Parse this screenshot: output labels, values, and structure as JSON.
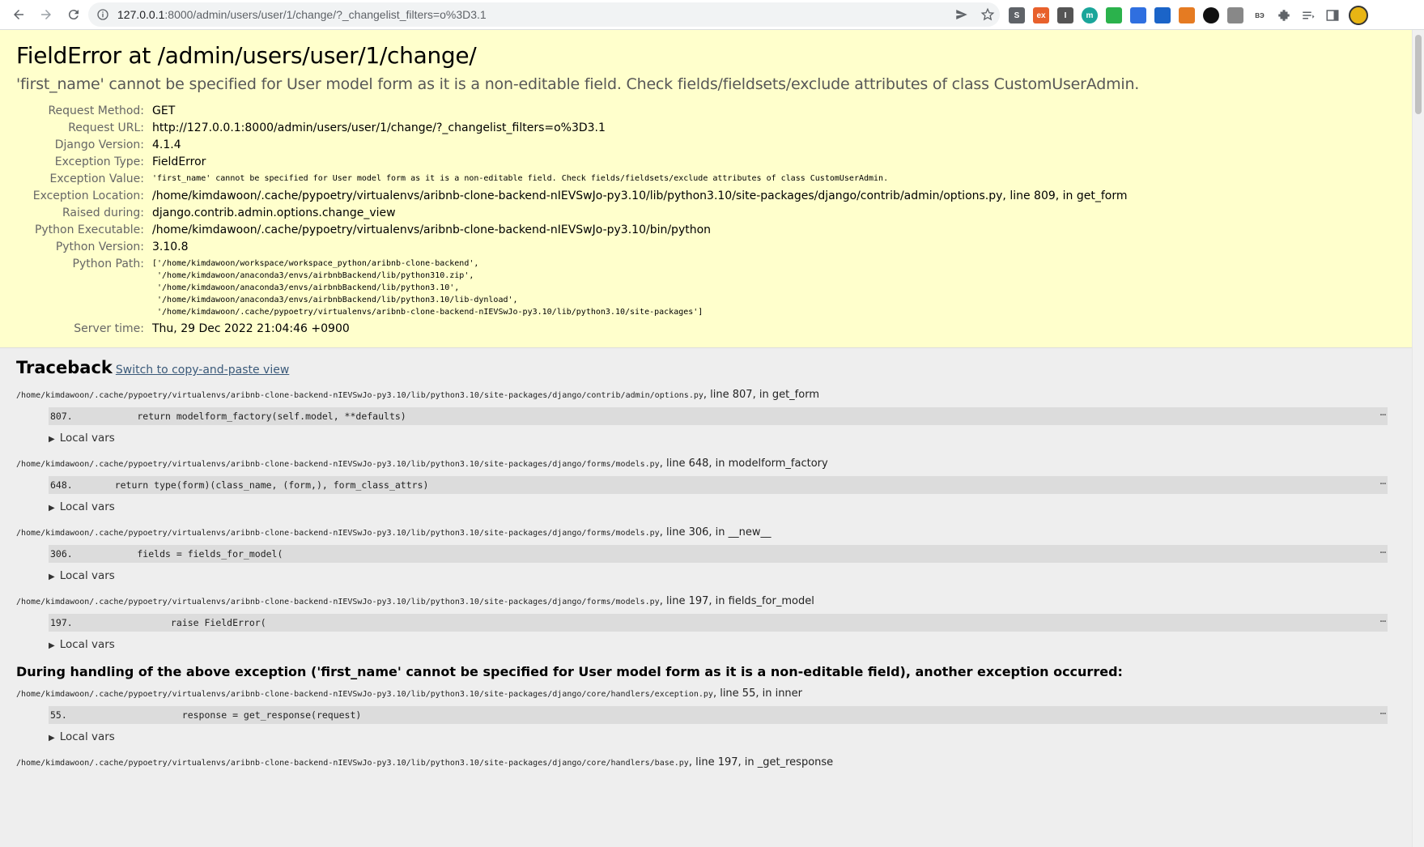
{
  "browser": {
    "url_host": "127.0.0.1",
    "url_rest": ":8000/admin/users/user/1/change/?_changelist_filters=o%3D3.1",
    "back_icon": "arrow-left-icon",
    "forward_icon": "arrow-right-icon",
    "reload_icon": "reload-icon",
    "extensions": [
      "S",
      "ex",
      "I",
      "m",
      "",
      "",
      "",
      "",
      "",
      "",
      "ВЭ",
      "",
      "",
      ""
    ]
  },
  "summary": {
    "title": "FieldError at /admin/users/user/1/change/",
    "message": "'first_name' cannot be specified for User model form as it is a non-editable field. Check fields/fieldsets/exclude attributes of class CustomUserAdmin.",
    "rows": {
      "request_method_label": "Request Method:",
      "request_method": "GET",
      "request_url_label": "Request URL:",
      "request_url": "http://127.0.0.1:8000/admin/users/user/1/change/?_changelist_filters=o%3D3.1",
      "django_version_label": "Django Version:",
      "django_version": "4.1.4",
      "exception_type_label": "Exception Type:",
      "exception_type": "FieldError",
      "exception_value_label": "Exception Value:",
      "exception_value": "'first_name' cannot be specified for User model form as it is a non-editable field. Check fields/fieldsets/exclude attributes of class CustomUserAdmin.",
      "exception_location_label": "Exception Location:",
      "exception_location": "/home/kimdawoon/.cache/pypoetry/virtualenvs/aribnb-clone-backend-nIEVSwJo-py3.10/lib/python3.10/site-packages/django/contrib/admin/options.py, line 809, in get_form",
      "raised_during_label": "Raised during:",
      "raised_during": "django.contrib.admin.options.change_view",
      "python_executable_label": "Python Executable:",
      "python_executable": "/home/kimdawoon/.cache/pypoetry/virtualenvs/aribnb-clone-backend-nIEVSwJo-py3.10/bin/python",
      "python_version_label": "Python Version:",
      "python_version": "3.10.8",
      "python_path_label": "Python Path:",
      "python_path": "['/home/kimdawoon/workspace/workspace_python/aribnb-clone-backend',\n '/home/kimdawoon/anaconda3/envs/airbnbBackend/lib/python310.zip',\n '/home/kimdawoon/anaconda3/envs/airbnbBackend/lib/python3.10',\n '/home/kimdawoon/anaconda3/envs/airbnbBackend/lib/python3.10/lib-dynload',\n '/home/kimdawoon/.cache/pypoetry/virtualenvs/aribnb-clone-backend-nIEVSwJo-py3.10/lib/python3.10/site-packages']",
      "server_time_label": "Server time:",
      "server_time": "Thu, 29 Dec 2022 21:04:46 +0900"
    }
  },
  "traceback": {
    "title": "Traceback",
    "switch_link": "Switch to copy-and-paste view",
    "local_vars_label": "Local vars",
    "dots": "⋯",
    "frames": [
      {
        "path": "/home/kimdawoon/.cache/pypoetry/virtualenvs/aribnb-clone-backend-nIEVSwJo-py3.10/lib/python3.10/site-packages/django/contrib/admin/options.py",
        "where": ", line 807, in get_form",
        "lineno": "807.",
        "code": "        return modelform_factory(self.model, **defaults)"
      },
      {
        "path": "/home/kimdawoon/.cache/pypoetry/virtualenvs/aribnb-clone-backend-nIEVSwJo-py3.10/lib/python3.10/site-packages/django/forms/models.py",
        "where": ", line 648, in modelform_factory",
        "lineno": "648.",
        "code": "    return type(form)(class_name, (form,), form_class_attrs)"
      },
      {
        "path": "/home/kimdawoon/.cache/pypoetry/virtualenvs/aribnb-clone-backend-nIEVSwJo-py3.10/lib/python3.10/site-packages/django/forms/models.py",
        "where": ", line 306, in __new__",
        "lineno": "306.",
        "code": "        fields = fields_for_model("
      },
      {
        "path": "/home/kimdawoon/.cache/pypoetry/virtualenvs/aribnb-clone-backend-nIEVSwJo-py3.10/lib/python3.10/site-packages/django/forms/models.py",
        "where": ", line 197, in fields_for_model",
        "lineno": "197.",
        "code": "              raise FieldError("
      }
    ],
    "handling_text": "During handling of the above exception ('first_name' cannot be specified for User model form as it is a non-editable field), another exception occurred:",
    "frames2": [
      {
        "path": "/home/kimdawoon/.cache/pypoetry/virtualenvs/aribnb-clone-backend-nIEVSwJo-py3.10/lib/python3.10/site-packages/django/core/handlers/exception.py",
        "where": ", line 55, in inner",
        "lineno": "55.",
        "code": "                response = get_response(request)"
      },
      {
        "path": "/home/kimdawoon/.cache/pypoetry/virtualenvs/aribnb-clone-backend-nIEVSwJo-py3.10/lib/python3.10/site-packages/django/core/handlers/base.py",
        "where": ", line 197, in _get_response"
      }
    ]
  }
}
